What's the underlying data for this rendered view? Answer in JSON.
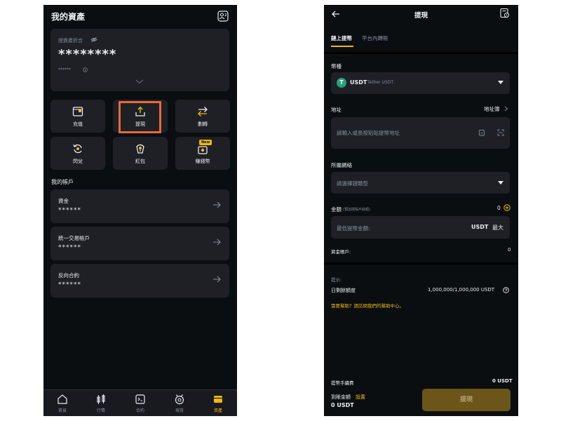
{
  "left": {
    "title": "我的資產",
    "overview": {
      "label": "總資產折合",
      "value": "********",
      "sub": "******"
    },
    "actions": [
      {
        "label": "充值",
        "icon": "deposit-icon"
      },
      {
        "label": "提現",
        "icon": "withdraw-icon"
      },
      {
        "label": "劃轉",
        "icon": "transfer-icon"
      },
      {
        "label": "閃兌",
        "icon": "convert-icon"
      },
      {
        "label": "紅包",
        "icon": "red-packet-icon"
      },
      {
        "label": "賺錢幣",
        "icon": "earn-icon",
        "badge": "New"
      }
    ],
    "accounts_title": "我的帳戶",
    "accounts": [
      {
        "name": "資金",
        "value": "******"
      },
      {
        "name": "統一交易帳戶",
        "value": "******"
      },
      {
        "name": "反向合約",
        "value": "******"
      }
    ],
    "nav": [
      {
        "label": "首頁",
        "icon": "home-icon"
      },
      {
        "label": "行情",
        "icon": "market-icon"
      },
      {
        "label": "合約",
        "icon": "futures-icon"
      },
      {
        "label": "現貨",
        "icon": "spot-icon"
      },
      {
        "label": "資產",
        "icon": "assets-icon",
        "active": true
      }
    ]
  },
  "right": {
    "title": "提現",
    "tabs": [
      {
        "label": "鏈上提幣",
        "active": true
      },
      {
        "label": "平台內轉賬",
        "active": false
      }
    ],
    "coin_label": "幣種",
    "coin_symbol": "USDT",
    "coin_name": "Tether USDT",
    "coin_badge": "T",
    "address_label": "地址",
    "address_book": "地址簿",
    "address_placeholder": "請輸入或長按粘貼提幣地址",
    "network_label": "所屬網絡",
    "network_placeholder": "請選擇鏈類型",
    "amount_label": "金額",
    "amount_hint": "(預加境賬戶餘額)",
    "amount_balance": "0",
    "amount_placeholder": "最低提幣金額:",
    "amount_unit": "USDT",
    "amount_max": "最大",
    "funding_label": "資金帳戶:",
    "funding_value": "0",
    "tips_label": "提示:",
    "daily_label": "日剩餘額度",
    "daily_value": "1,000,000/1,000,000 USDT",
    "help_text": "需要幫助？請訪問我們的幫助中心。",
    "fee_label": "提幣手續費",
    "fee_value": "0 USDT",
    "receive_label": "到賬金額",
    "receive_settings": "設置",
    "receive_value": "0 USDT",
    "submit_label": "提現"
  },
  "colors": {
    "accent": "#f0b90b",
    "highlight": "#e8693a",
    "coin_green": "#26a17b"
  }
}
